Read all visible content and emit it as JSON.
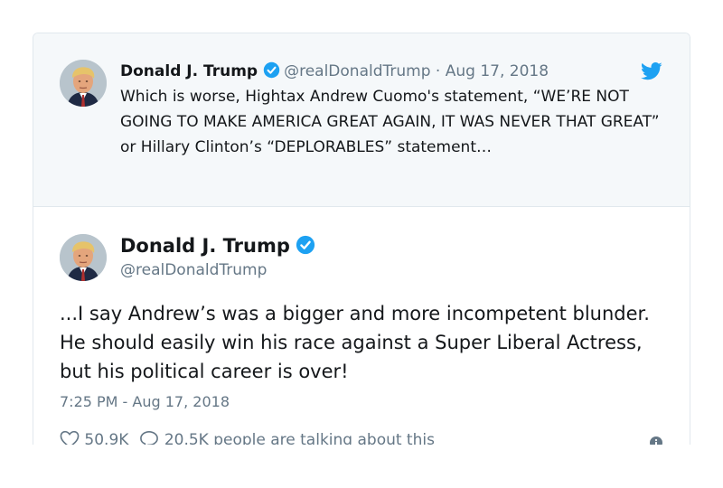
{
  "quoted_tweet": {
    "author_name": "Donald J. Trump",
    "handle": "@realDonaldTrump",
    "separator": "·",
    "date": "Aug 17, 2018",
    "text": "Which is worse, Hightax Andrew Cuomo's statement, “WE’RE NOT GOING TO MAKE AMERICA GREAT AGAIN, IT WAS NEVER THAT GREAT” or Hillary Clinton’s “DEPLORABLES” statement…",
    "icons": [
      "verified-badge-icon",
      "twitter-bird-icon"
    ]
  },
  "main_tweet": {
    "author_name": "Donald J. Trump",
    "handle": "@realDonaldTrump",
    "text": "...I say Andrew’s was a bigger and more incompetent blunder. He should easily win his race against a Super Liberal Actress, but his political career is over!",
    "timestamp": "7:25 PM - Aug 17, 2018",
    "likes": "50.9K",
    "replies_text": "20.5K people are talking about this",
    "icons": [
      "heart-icon",
      "comment-icon",
      "info-icon",
      "verified-badge-icon"
    ]
  },
  "colors": {
    "text": "#14171a",
    "secondary": "#657786",
    "accent": "#1da1f2",
    "quoted_background": "#f5f8fa",
    "border": "#e1e8ed"
  }
}
